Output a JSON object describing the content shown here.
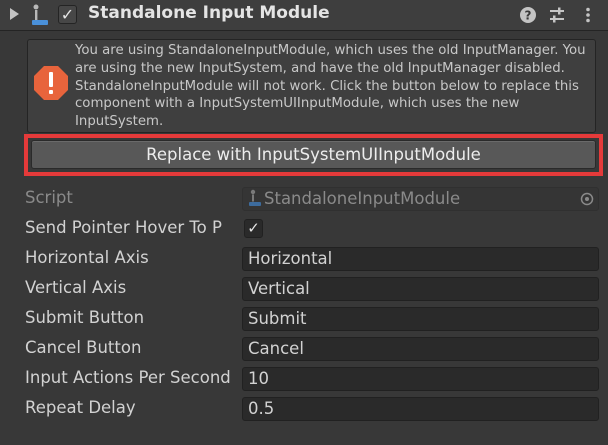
{
  "header": {
    "title": "Standalone Input Module",
    "enabled_mark": "✓",
    "icons": [
      "foldout-arrow-icon",
      "input-module-icon",
      "help-icon",
      "preset-icon",
      "context-menu-icon"
    ]
  },
  "helpbox": {
    "icon": "warning-icon",
    "text": "You are using StandaloneInputModule, which uses the old InputManager. You are using the new InputSystem, and have the old InputManager disabled. StandaloneInputModule will not work. Click the button below to replace this component with a InputSystemUIInputModule, which uses the new InputSystem."
  },
  "replace_button": {
    "label": "Replace with InputSystemUIInputModule",
    "highlight_color": "#e53a3a"
  },
  "fields": {
    "script": {
      "label": "Script",
      "value": "StandaloneInputModule"
    },
    "send_pointer_hover": {
      "label": "Send Pointer Hover To P",
      "checked_mark": "✓"
    },
    "horizontal_axis": {
      "label": "Horizontal Axis",
      "value": "Horizontal"
    },
    "vertical_axis": {
      "label": "Vertical Axis",
      "value": "Vertical"
    },
    "submit_button": {
      "label": "Submit Button",
      "value": "Submit"
    },
    "cancel_button": {
      "label": "Cancel Button",
      "value": "Cancel"
    },
    "input_actions_per_second": {
      "label": "Input Actions Per Second",
      "value": "10"
    },
    "repeat_delay": {
      "label": "Repeat Delay",
      "value": "0.5"
    }
  }
}
